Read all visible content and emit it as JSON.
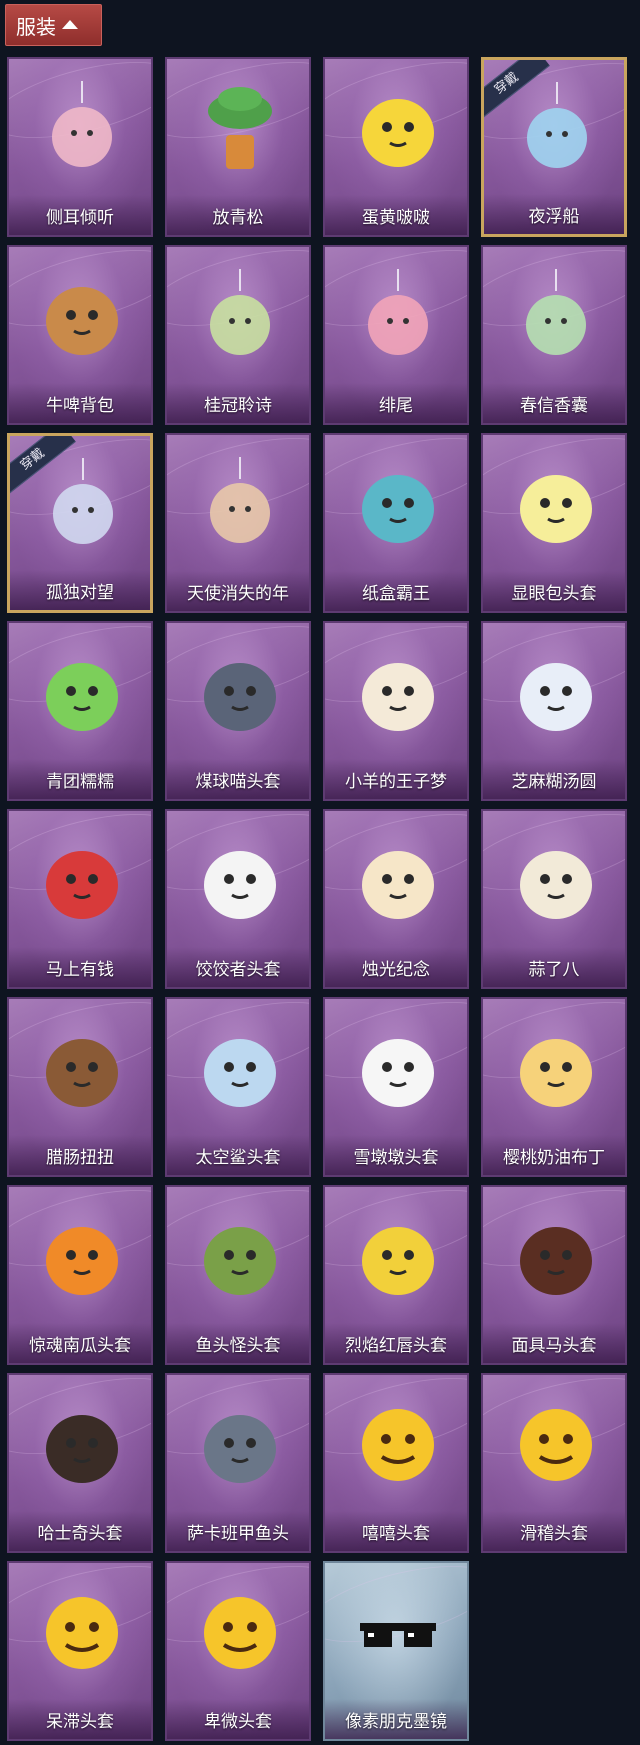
{
  "header": {
    "title": "服装"
  },
  "equipped_badge": "穿戴",
  "items": [
    {
      "name": "侧耳倾听",
      "icon": "flower-wreath-charm",
      "equipped": false,
      "frame": "purple",
      "color": "#f0b8c8"
    },
    {
      "name": "放青松",
      "icon": "potted-pine",
      "equipped": false,
      "frame": "purple",
      "color": "#4fa04a"
    },
    {
      "name": "蛋黄啵啵",
      "icon": "chick-in-eggshell",
      "equipped": false,
      "frame": "purple",
      "color": "#f6d63a"
    },
    {
      "name": "夜浮船",
      "icon": "jellyfish-charm",
      "equipped": true,
      "frame": "purple",
      "color": "#9fd4f0"
    },
    {
      "name": "牛啤背包",
      "icon": "cow-barrel-backpack",
      "equipped": false,
      "frame": "purple",
      "color": "#c98a4a"
    },
    {
      "name": "桂冠聆诗",
      "icon": "laurel-doll-charm",
      "equipped": false,
      "frame": "purple",
      "color": "#c8e0a0"
    },
    {
      "name": "绯尾",
      "icon": "fox-doll-charm",
      "equipped": false,
      "frame": "purple",
      "color": "#f2a4b8"
    },
    {
      "name": "春信香囊",
      "icon": "sachet-charm",
      "equipped": false,
      "frame": "purple",
      "color": "#b5e0b0"
    },
    {
      "name": "孤独对望",
      "icon": "silver-hair-doll-charm",
      "equipped": true,
      "frame": "purple",
      "color": "#d0d8f0"
    },
    {
      "name": "天使消失的年",
      "icon": "angel-girl-charm",
      "equipped": false,
      "frame": "purple",
      "color": "#e8c8a8"
    },
    {
      "name": "纸盒霸王",
      "icon": "box-dinosaur-head",
      "equipped": false,
      "frame": "purple",
      "color": "#5ab7c8"
    },
    {
      "name": "显眼包头套",
      "icon": "bulb-crown-head",
      "equipped": false,
      "frame": "purple",
      "color": "#f6ee9a"
    },
    {
      "name": "青团糯糯",
      "icon": "green-rice-ball-head",
      "equipped": false,
      "frame": "purple",
      "color": "#7ccf5a"
    },
    {
      "name": "煤球喵头套",
      "icon": "gray-cat-head",
      "equipped": false,
      "frame": "purple",
      "color": "#5a6478"
    },
    {
      "name": "小羊的王子梦",
      "icon": "sheep-crown-head",
      "equipped": false,
      "frame": "purple",
      "color": "#f4ead8"
    },
    {
      "name": "芝麻糊汤圆",
      "icon": "dumpling-flower-head",
      "equipped": false,
      "frame": "purple",
      "color": "#e8eef8"
    },
    {
      "name": "马上有钱",
      "icon": "red-horse-head",
      "equipped": false,
      "frame": "purple",
      "color": "#d83a3a"
    },
    {
      "name": "饺饺者头套",
      "icon": "cloud-dumpling-head",
      "equipped": false,
      "frame": "purple",
      "color": "#f4f4f4"
    },
    {
      "name": "烛光纪念",
      "icon": "candle-head",
      "equipped": false,
      "frame": "purple",
      "color": "#f6e6c8"
    },
    {
      "name": "蒜了八",
      "icon": "garlic-head",
      "equipped": false,
      "frame": "purple",
      "color": "#f2ead8"
    },
    {
      "name": "腊肠扭扭",
      "icon": "dachshund-head",
      "equipped": false,
      "frame": "purple",
      "color": "#8a5a36"
    },
    {
      "name": "太空鲨头套",
      "icon": "shark-head",
      "equipped": false,
      "frame": "purple",
      "color": "#bcd8f0"
    },
    {
      "name": "雪墩墩头套",
      "icon": "snowman-head",
      "equipped": false,
      "frame": "purple",
      "color": "#f6f6f6"
    },
    {
      "name": "樱桃奶油布丁",
      "icon": "pudding-head",
      "equipped": false,
      "frame": "purple",
      "color": "#f6d27a"
    },
    {
      "name": "惊魂南瓜头套",
      "icon": "pumpkin-head",
      "equipped": false,
      "frame": "purple",
      "color": "#f08a28"
    },
    {
      "name": "鱼头怪头套",
      "icon": "fish-monster-head",
      "equipped": false,
      "frame": "purple",
      "color": "#7aa048"
    },
    {
      "name": "烈焰红唇头套",
      "icon": "yellow-pika-sunglasses-head",
      "equipped": false,
      "frame": "purple",
      "color": "#f2d03a"
    },
    {
      "name": "面具马头套",
      "icon": "horse-mask-head",
      "equipped": false,
      "frame": "purple",
      "color": "#5a2e22"
    },
    {
      "name": "哈士奇头套",
      "icon": "husky-sunglasses-head",
      "equipped": false,
      "frame": "purple",
      "color": "#3a2c26"
    },
    {
      "name": "萨卡班甲鱼头",
      "icon": "sacabambaspis-head",
      "equipped": false,
      "frame": "purple",
      "color": "#6a7688"
    },
    {
      "name": "嘻嘻头套",
      "icon": "grinning-emoji-head",
      "equipped": false,
      "frame": "purple",
      "color": "#f6c52a"
    },
    {
      "name": "滑稽头套",
      "icon": "smirk-emoji-head",
      "equipped": false,
      "frame": "purple",
      "color": "#f6c52a"
    },
    {
      "name": "呆滞头套",
      "icon": "staring-emoji-head",
      "equipped": false,
      "frame": "purple",
      "color": "#f6c52a"
    },
    {
      "name": "卑微头套",
      "icon": "shy-emoji-head",
      "equipped": false,
      "frame": "purple",
      "color": "#f6c52a"
    },
    {
      "name": "像素朋克墨镜",
      "icon": "pixel-sunglasses",
      "equipped": false,
      "frame": "silver",
      "color": "#111111"
    }
  ]
}
